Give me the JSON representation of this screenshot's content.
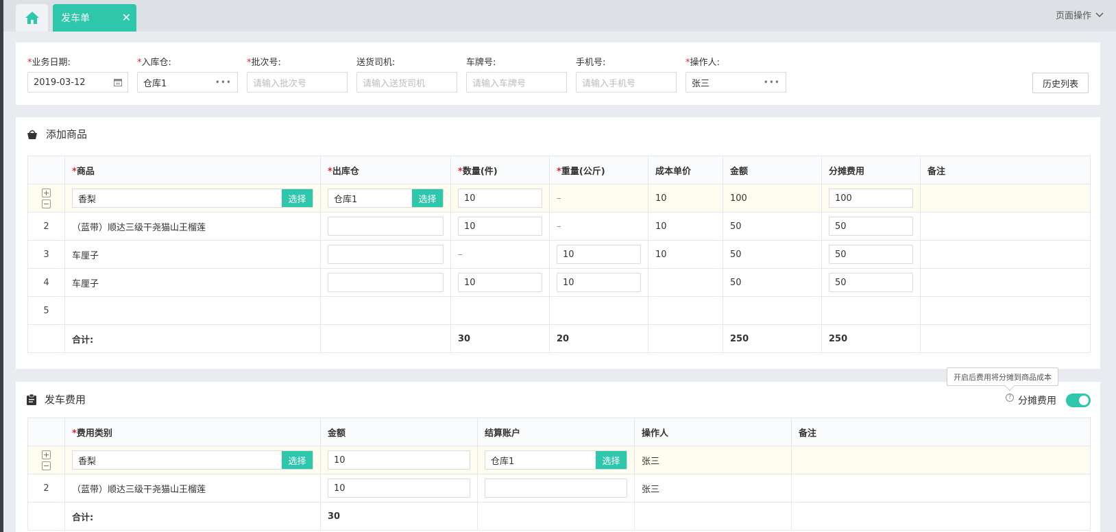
{
  "tabs": {
    "home_icon": "home-icon",
    "active_label": "发车单",
    "close_glyph": "✕"
  },
  "page_ops": {
    "label": "页面操作"
  },
  "form": {
    "business_date": {
      "label": "业务日期:",
      "value": "2019-03-12"
    },
    "in_warehouse": {
      "label": "入库仓:",
      "value": "仓库1"
    },
    "batch_no": {
      "label": "批次号:",
      "placeholder": "请输入批次号"
    },
    "driver": {
      "label": "送货司机:",
      "placeholder": "请输入送货司机"
    },
    "plate_no": {
      "label": "车牌号:",
      "placeholder": "请输入车牌号"
    },
    "phone": {
      "label": "手机号:",
      "placeholder": "请输入手机号"
    },
    "operator": {
      "label": "操作人:",
      "value": "张三"
    },
    "history_button": "历史列表",
    "required_mark": "*"
  },
  "goods": {
    "title": "添加商品",
    "headers": [
      "商品",
      "出库仓",
      "数量(件)",
      "重量(公斤)",
      "成本单价",
      "金额",
      "分摊费用",
      "备注"
    ],
    "select_label": "选择",
    "rows": [
      {
        "product": "香梨",
        "warehouse": "仓库1",
        "qty": "10",
        "weight": "–",
        "unit_cost": "10",
        "amount": "100",
        "share": "100"
      },
      {
        "index": "2",
        "product": "（蓝带）顺达三级干尧猫山王榴莲",
        "warehouse": "",
        "qty": "10",
        "weight": "–",
        "unit_cost": "10",
        "amount": "50",
        "share": "50"
      },
      {
        "index": "3",
        "product": "车厘子",
        "warehouse": "",
        "qty": "–",
        "weight": "10",
        "unit_cost": "10",
        "amount": "50",
        "share": "50"
      },
      {
        "index": "4",
        "product": "车厘子",
        "warehouse": "",
        "qty": "10",
        "weight": "10",
        "unit_cost": "",
        "amount": "50",
        "share": "50"
      },
      {
        "index": "5"
      }
    ],
    "total": {
      "label": "合计:",
      "qty": "30",
      "weight": "20",
      "amount": "250",
      "share": "250"
    }
  },
  "fees": {
    "title": "发车费用",
    "tooltip": "开启后费用将分摊到商品成本",
    "share_label": "分摊费用",
    "share_enabled": true,
    "headers": [
      "费用类别",
      "金额",
      "结算账户",
      "操作人",
      "备注"
    ],
    "select_label": "选择",
    "rows": [
      {
        "category": "香梨",
        "amount": "10",
        "account": "仓库1",
        "operator": "张三"
      },
      {
        "index": "2",
        "category": "（蓝带）顺达三级干尧猫山王榴莲",
        "amount": "10",
        "account": "",
        "operator": "张三"
      }
    ],
    "total": {
      "label": "合计:",
      "amount": "30"
    }
  },
  "colors": {
    "accent": "#2ec7ab",
    "required": "#e0242a",
    "row_highlight": "#fffdf0"
  }
}
